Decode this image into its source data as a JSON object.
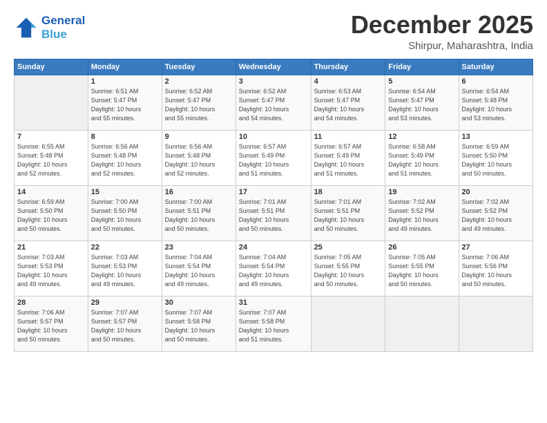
{
  "header": {
    "logo_line1": "General",
    "logo_line2": "Blue",
    "month": "December 2025",
    "location": "Shirpur, Maharashtra, India"
  },
  "weekdays": [
    "Sunday",
    "Monday",
    "Tuesday",
    "Wednesday",
    "Thursday",
    "Friday",
    "Saturday"
  ],
  "weeks": [
    [
      {
        "day": "",
        "info": ""
      },
      {
        "day": "1",
        "info": "Sunrise: 6:51 AM\nSunset: 5:47 PM\nDaylight: 10 hours\nand 55 minutes."
      },
      {
        "day": "2",
        "info": "Sunrise: 6:52 AM\nSunset: 5:47 PM\nDaylight: 10 hours\nand 55 minutes."
      },
      {
        "day": "3",
        "info": "Sunrise: 6:52 AM\nSunset: 5:47 PM\nDaylight: 10 hours\nand 54 minutes."
      },
      {
        "day": "4",
        "info": "Sunrise: 6:53 AM\nSunset: 5:47 PM\nDaylight: 10 hours\nand 54 minutes."
      },
      {
        "day": "5",
        "info": "Sunrise: 6:54 AM\nSunset: 5:47 PM\nDaylight: 10 hours\nand 53 minutes."
      },
      {
        "day": "6",
        "info": "Sunrise: 6:54 AM\nSunset: 5:48 PM\nDaylight: 10 hours\nand 53 minutes."
      }
    ],
    [
      {
        "day": "7",
        "info": "Sunrise: 6:55 AM\nSunset: 5:48 PM\nDaylight: 10 hours\nand 52 minutes."
      },
      {
        "day": "8",
        "info": "Sunrise: 6:56 AM\nSunset: 5:48 PM\nDaylight: 10 hours\nand 52 minutes."
      },
      {
        "day": "9",
        "info": "Sunrise: 6:56 AM\nSunset: 5:48 PM\nDaylight: 10 hours\nand 52 minutes."
      },
      {
        "day": "10",
        "info": "Sunrise: 6:57 AM\nSunset: 5:49 PM\nDaylight: 10 hours\nand 51 minutes."
      },
      {
        "day": "11",
        "info": "Sunrise: 6:57 AM\nSunset: 5:49 PM\nDaylight: 10 hours\nand 51 minutes."
      },
      {
        "day": "12",
        "info": "Sunrise: 6:58 AM\nSunset: 5:49 PM\nDaylight: 10 hours\nand 51 minutes."
      },
      {
        "day": "13",
        "info": "Sunrise: 6:59 AM\nSunset: 5:50 PM\nDaylight: 10 hours\nand 50 minutes."
      }
    ],
    [
      {
        "day": "14",
        "info": "Sunrise: 6:59 AM\nSunset: 5:50 PM\nDaylight: 10 hours\nand 50 minutes."
      },
      {
        "day": "15",
        "info": "Sunrise: 7:00 AM\nSunset: 5:50 PM\nDaylight: 10 hours\nand 50 minutes."
      },
      {
        "day": "16",
        "info": "Sunrise: 7:00 AM\nSunset: 5:51 PM\nDaylight: 10 hours\nand 50 minutes."
      },
      {
        "day": "17",
        "info": "Sunrise: 7:01 AM\nSunset: 5:51 PM\nDaylight: 10 hours\nand 50 minutes."
      },
      {
        "day": "18",
        "info": "Sunrise: 7:01 AM\nSunset: 5:51 PM\nDaylight: 10 hours\nand 50 minutes."
      },
      {
        "day": "19",
        "info": "Sunrise: 7:02 AM\nSunset: 5:52 PM\nDaylight: 10 hours\nand 49 minutes."
      },
      {
        "day": "20",
        "info": "Sunrise: 7:02 AM\nSunset: 5:52 PM\nDaylight: 10 hours\nand 49 minutes."
      }
    ],
    [
      {
        "day": "21",
        "info": "Sunrise: 7:03 AM\nSunset: 5:53 PM\nDaylight: 10 hours\nand 49 minutes."
      },
      {
        "day": "22",
        "info": "Sunrise: 7:03 AM\nSunset: 5:53 PM\nDaylight: 10 hours\nand 49 minutes."
      },
      {
        "day": "23",
        "info": "Sunrise: 7:04 AM\nSunset: 5:54 PM\nDaylight: 10 hours\nand 49 minutes."
      },
      {
        "day": "24",
        "info": "Sunrise: 7:04 AM\nSunset: 5:54 PM\nDaylight: 10 hours\nand 49 minutes."
      },
      {
        "day": "25",
        "info": "Sunrise: 7:05 AM\nSunset: 5:55 PM\nDaylight: 10 hours\nand 50 minutes."
      },
      {
        "day": "26",
        "info": "Sunrise: 7:05 AM\nSunset: 5:55 PM\nDaylight: 10 hours\nand 50 minutes."
      },
      {
        "day": "27",
        "info": "Sunrise: 7:06 AM\nSunset: 5:56 PM\nDaylight: 10 hours\nand 50 minutes."
      }
    ],
    [
      {
        "day": "28",
        "info": "Sunrise: 7:06 AM\nSunset: 5:57 PM\nDaylight: 10 hours\nand 50 minutes."
      },
      {
        "day": "29",
        "info": "Sunrise: 7:07 AM\nSunset: 5:57 PM\nDaylight: 10 hours\nand 50 minutes."
      },
      {
        "day": "30",
        "info": "Sunrise: 7:07 AM\nSunset: 5:58 PM\nDaylight: 10 hours\nand 50 minutes."
      },
      {
        "day": "31",
        "info": "Sunrise: 7:07 AM\nSunset: 5:58 PM\nDaylight: 10 hours\nand 51 minutes."
      },
      {
        "day": "",
        "info": ""
      },
      {
        "day": "",
        "info": ""
      },
      {
        "day": "",
        "info": ""
      }
    ]
  ]
}
